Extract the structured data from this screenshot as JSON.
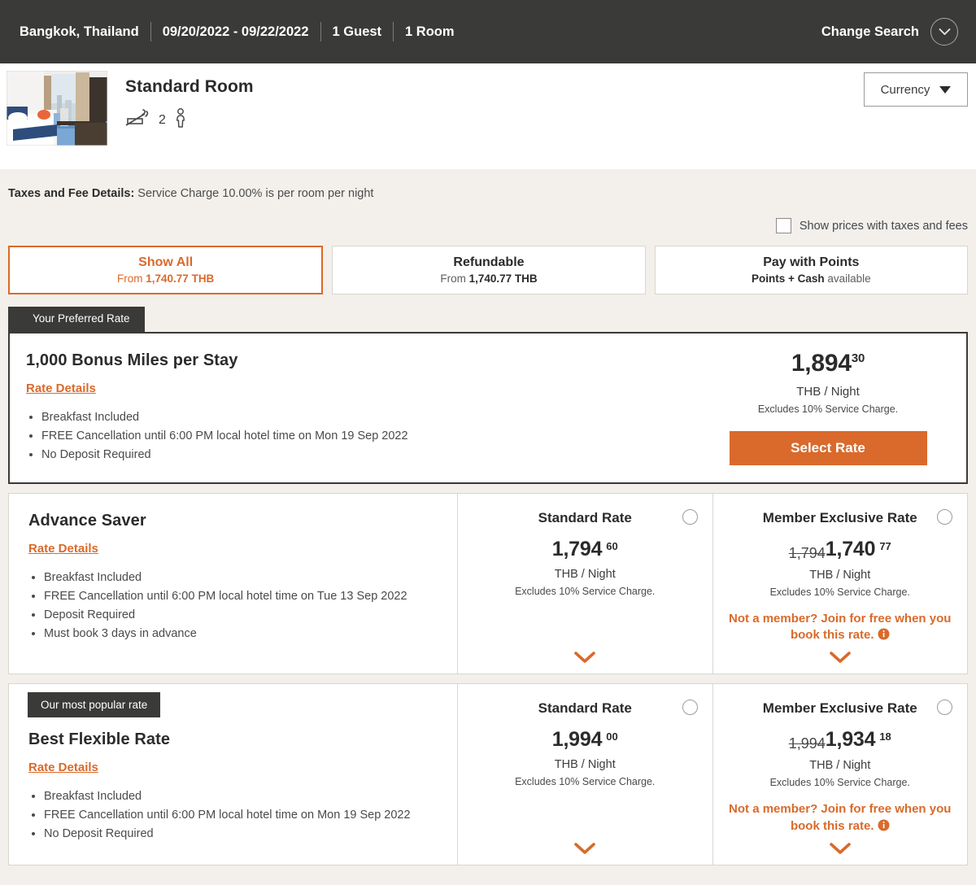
{
  "search_bar": {
    "destination": "Bangkok, Thailand",
    "dates": "09/20/2022 - 09/22/2022",
    "guests": "1 Guest",
    "rooms": "1 Room",
    "change_search_label": "Change Search",
    "chevron_icon": "chevron-down-icon"
  },
  "room": {
    "title": "Standard Room",
    "smoking_icon": "no-smoking-icon",
    "occupancy_count": "2",
    "occupancy_icon": "person-icon",
    "currency_label": "Currency",
    "currency_caret_icon": "caret-down-icon"
  },
  "taxes": {
    "label": "Taxes and Fee Details:",
    "text": " Service Charge 10.00% is per room per night",
    "show_prices_label": "Show prices with taxes and fees",
    "show_prices_checked": false
  },
  "filters": [
    {
      "title": "Show All",
      "from_label": "From ",
      "amount": "1,740.77 THB",
      "active": true
    },
    {
      "title": "Refundable",
      "from_label": "From ",
      "amount": "1,740.77 THB",
      "active": false
    },
    {
      "title": "Pay with Points",
      "from_label": "Points + Cash",
      "amount": " available",
      "active": false
    }
  ],
  "preferred_rate": {
    "ribbon": "Your Preferred Rate",
    "name": "1,000 Bonus Miles per Stay",
    "rate_details_label": "Rate Details",
    "bullets": [
      "Breakfast Included",
      "FREE Cancellation until 6:00 PM local hotel time on Mon 19 Sep 2022",
      "No Deposit Required"
    ],
    "price_whole": "1,894",
    "price_cents": "30",
    "unit": "THB / Night",
    "note": "Excludes 10% Service Charge.",
    "select_button": "Select Rate"
  },
  "rate_cards": [
    {
      "ribbon": null,
      "name": "Advance Saver",
      "rate_details_label": "Rate Details",
      "bullets": [
        "Breakfast Included",
        "FREE Cancellation until 6:00 PM local hotel time on Tue 13 Sep 2022",
        "Deposit Required",
        "Must book 3 days in advance"
      ],
      "standard": {
        "heading": "Standard Rate",
        "old_price": "",
        "price": "1,794",
        "cents": "60",
        "unit": "THB / Night",
        "note": "Excludes 10% Service Charge.",
        "cta": "",
        "chevron_icon": "chevron-down-icon",
        "radio_icon": "radio-unchecked-icon"
      },
      "member": {
        "heading": "Member Exclusive Rate",
        "old_price": "1,794",
        "price": "1,740",
        "cents": "77",
        "unit": "THB / Night",
        "note": "Excludes 10% Service Charge.",
        "cta": "Not a member? Join for free when you book this rate.",
        "info_icon": "info-icon",
        "chevron_icon": "chevron-down-icon",
        "radio_icon": "radio-unchecked-icon"
      }
    },
    {
      "ribbon": "Our most popular rate",
      "name": "Best Flexible Rate",
      "rate_details_label": "Rate Details",
      "bullets": [
        "Breakfast Included",
        "FREE Cancellation until 6:00 PM local hotel time on Mon 19 Sep 2022",
        "No Deposit Required"
      ],
      "standard": {
        "heading": "Standard Rate",
        "old_price": "",
        "price": "1,994",
        "cents": "00",
        "unit": "THB / Night",
        "note": "Excludes 10% Service Charge.",
        "cta": "",
        "chevron_icon": "chevron-down-icon",
        "radio_icon": "radio-unchecked-icon"
      },
      "member": {
        "heading": "Member Exclusive Rate",
        "old_price": "1,994",
        "price": "1,934",
        "cents": "18",
        "unit": "THB / Night",
        "note": "Excludes 10% Service Charge.",
        "cta": "Not a member? Join for free when you book this rate.",
        "info_icon": "info-icon",
        "chevron_icon": "chevron-down-icon",
        "radio_icon": "radio-unchecked-icon"
      }
    }
  ],
  "colors": {
    "accent_orange": "#D96A2B",
    "dark_bar": "#3A3A38",
    "page_bg": "#F3F0EB"
  }
}
